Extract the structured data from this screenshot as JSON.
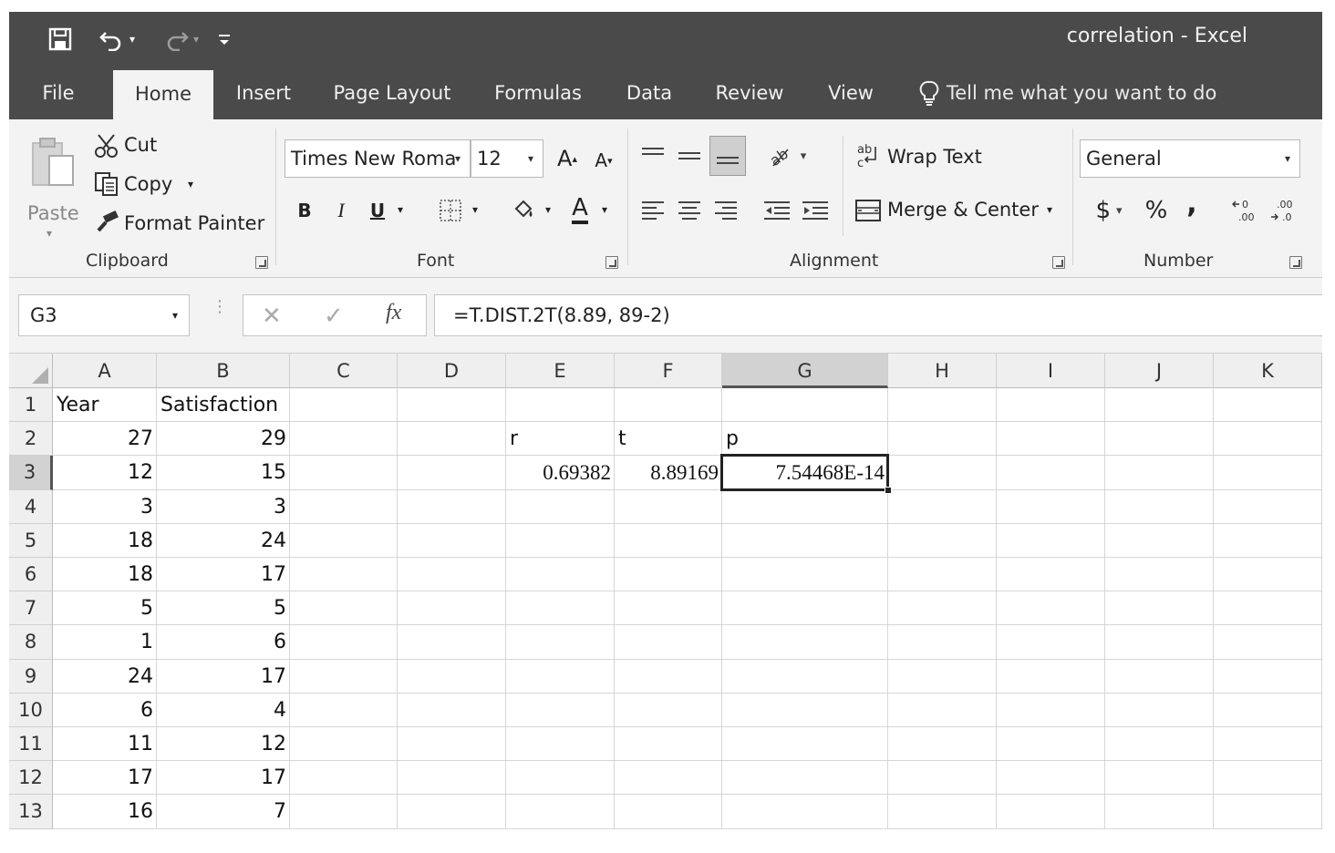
{
  "window": {
    "title": "correlation  -  Excel"
  },
  "tabs": [
    {
      "label": "File"
    },
    {
      "label": "Home"
    },
    {
      "label": "Insert"
    },
    {
      "label": "Page Layout"
    },
    {
      "label": "Formulas"
    },
    {
      "label": "Data"
    },
    {
      "label": "Review"
    },
    {
      "label": "View"
    }
  ],
  "tell_me": "Tell me what you want to do",
  "ribbon": {
    "clipboard": {
      "label": "Clipboard",
      "paste": "Paste",
      "cut": "Cut",
      "copy": "Copy",
      "format_painter": "Format Painter"
    },
    "font": {
      "label": "Font",
      "font_name": "Times New Roma",
      "font_size": "12",
      "bold": "B",
      "italic": "I",
      "underline": "U"
    },
    "alignment": {
      "label": "Alignment",
      "wrap_text": "Wrap Text",
      "merge_center": "Merge & Center"
    },
    "number": {
      "label": "Number",
      "format": "General",
      "currency": "$",
      "percent": "%",
      "comma": ","
    }
  },
  "formula_bar": {
    "name_box": "G3",
    "formula": "=T.DIST.2T(8.89, 89-2)"
  },
  "sheet": {
    "columns": [
      "A",
      "B",
      "C",
      "D",
      "E",
      "F",
      "G",
      "H",
      "I",
      "J",
      "K"
    ],
    "rows": [
      "1",
      "2",
      "3",
      "4",
      "5",
      "6",
      "7",
      "8",
      "9",
      "10",
      "11",
      "12",
      "13"
    ],
    "selected_cell": "G3",
    "header_row": {
      "A": "Year",
      "B": "Satisfaction"
    },
    "data_rows": [
      {
        "A": "27",
        "B": "29"
      },
      {
        "A": "12",
        "B": "15"
      },
      {
        "A": "3",
        "B": "3"
      },
      {
        "A": "18",
        "B": "24"
      },
      {
        "A": "18",
        "B": "17"
      },
      {
        "A": "5",
        "B": "5"
      },
      {
        "A": "1",
        "B": "6"
      },
      {
        "A": "24",
        "B": "17"
      },
      {
        "A": "6",
        "B": "4"
      },
      {
        "A": "11",
        "B": "12"
      },
      {
        "A": "17",
        "B": "17"
      },
      {
        "A": "16",
        "B": "7"
      }
    ],
    "stats_labels": {
      "E": "r",
      "F": "t",
      "G": "p"
    },
    "stats_values": {
      "E": "0.69382",
      "F": "8.89169",
      "G": "7.54468E-14"
    }
  }
}
